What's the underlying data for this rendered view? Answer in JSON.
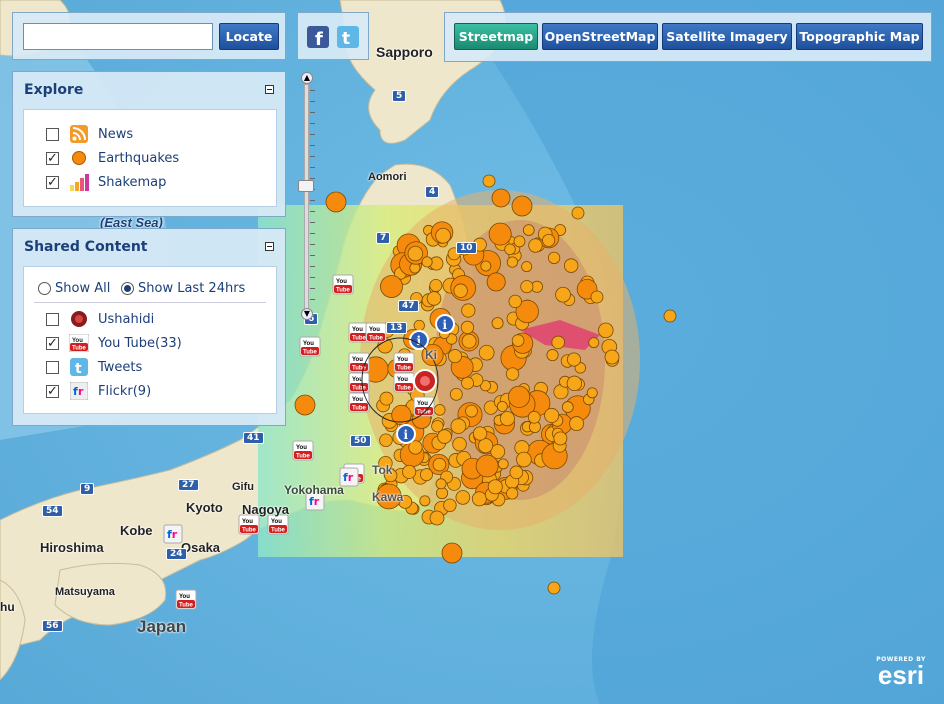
{
  "search": {
    "value": "",
    "button": "Locate"
  },
  "social": {
    "facebook": "facebook-icon",
    "twitter": "twitter-icon"
  },
  "basemaps": {
    "buttons": [
      "Streetmap",
      "OpenStreetMap",
      "Satellite Imagery",
      "Topographic Map"
    ],
    "active": "Streetmap"
  },
  "explore": {
    "title": "Explore",
    "items": [
      {
        "label": "News",
        "checked": false,
        "icon": "rss-icon"
      },
      {
        "label": "Earthquakes",
        "checked": true,
        "icon": "earthquake-dot-icon"
      },
      {
        "label": "Shakemap",
        "checked": true,
        "icon": "shakemap-bars-icon"
      }
    ]
  },
  "shared": {
    "title": "Shared Content",
    "filters": [
      {
        "label": "Show All",
        "selected": false
      },
      {
        "label": "Show Last 24hrs",
        "selected": true
      }
    ],
    "items": [
      {
        "label": "Ushahidi",
        "checked": false,
        "icon": "ushahidi-icon"
      },
      {
        "label": "You Tube(33)",
        "checked": true,
        "icon": "youtube-icon"
      },
      {
        "label": "Tweets",
        "checked": false,
        "icon": "twitter-icon"
      },
      {
        "label": "Flickr(9)",
        "checked": true,
        "icon": "flickr-icon"
      }
    ]
  },
  "map": {
    "place_labels": [
      "Sapporo",
      "Aomori",
      "(East Sea)",
      "Kyoto",
      "Kobe",
      "Osaka",
      "Hiroshima",
      "Nagoya",
      "Yokohama",
      "Gifu",
      "Matsuyama",
      "Japan",
      "hu",
      "Tok",
      "Kawa",
      "Ki"
    ],
    "road_shields": [
      "5",
      "4",
      "7",
      "13",
      "47",
      "50",
      "41",
      "27",
      "9",
      "54",
      "24",
      "56",
      "10",
      "6"
    ],
    "marker_icon_text": {
      "youtube": "You Tube",
      "flickr": "fr",
      "info": "i"
    },
    "zoom_level_fraction": 0.55
  },
  "attribution": {
    "top": "POWERED BY",
    "brand": "esri"
  },
  "colors": {
    "earthquake": "#f7a519",
    "earthquake_large": "#f58a0c",
    "accent": "#1c3f78",
    "active_button": "#25a087"
  }
}
